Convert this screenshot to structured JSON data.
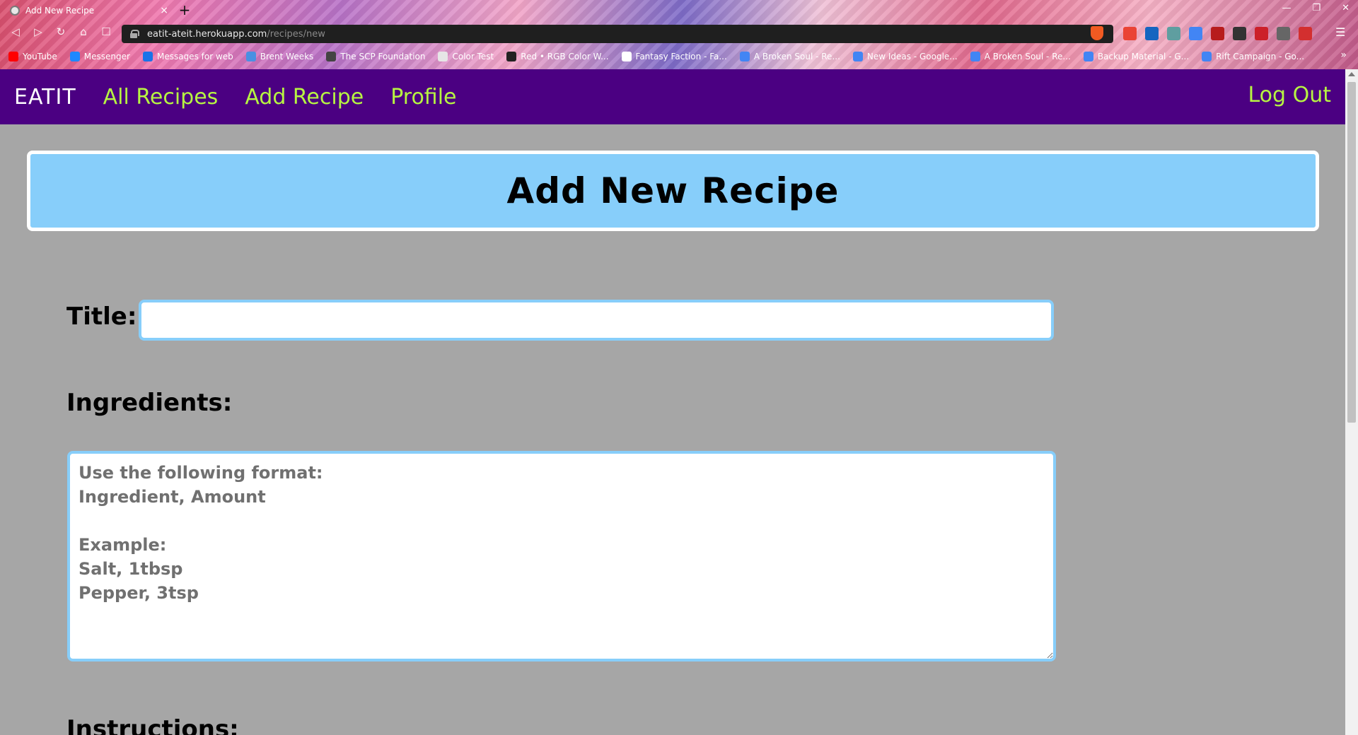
{
  "browser": {
    "tab_title": "Add New Recipe",
    "tab_close": "×",
    "new_tab": "+",
    "url_host": "eatit-ateit.herokuapp.com",
    "url_path": "/recipes/new",
    "bookmarks": [
      {
        "label": "YouTube",
        "color": "#ff0000"
      },
      {
        "label": "Messenger",
        "color": "#1e88ff"
      },
      {
        "label": "Messages for web",
        "color": "#1a73e8"
      },
      {
        "label": "Brent Weeks",
        "color": "#4a90e2"
      },
      {
        "label": "The SCP Foundation",
        "color": "#444444"
      },
      {
        "label": "Color Test",
        "color": "#e6e6e6"
      },
      {
        "label": "Red • RGB Color W...",
        "color": "#222222"
      },
      {
        "label": "Fantasy Faction - Fa...",
        "color": "#ffffff"
      },
      {
        "label": "A Broken Soul - Re...",
        "color": "#4285f4"
      },
      {
        "label": "New Ideas - Google...",
        "color": "#4285f4"
      },
      {
        "label": "A Broken Soul - Re...",
        "color": "#4285f4"
      },
      {
        "label": "Backup Material - G...",
        "color": "#4285f4"
      },
      {
        "label": "Rift Campaign - Go...",
        "color": "#4285f4"
      }
    ],
    "extensions": [
      {
        "name": "gmail-icon",
        "color": "#ea4335"
      },
      {
        "name": "extension-icon",
        "color": "#1565c0"
      },
      {
        "name": "calendar-icon",
        "color": "#5f9ea0"
      },
      {
        "name": "translate-icon",
        "color": "#4285f4"
      },
      {
        "name": "shield-icon",
        "color": "#b71c1c"
      },
      {
        "name": "ninja-icon",
        "color": "#333333"
      },
      {
        "name": "lastpass-icon",
        "color": "#cc2029"
      },
      {
        "name": "arrow-icon",
        "color": "#666666"
      },
      {
        "name": "pdf-icon",
        "color": "#d32f2f"
      }
    ]
  },
  "navbar": {
    "brand": "EATIT",
    "links": [
      "All Recipes",
      "Add Recipe",
      "Profile"
    ],
    "logout": "Log Out",
    "bg_color": "#4b0082",
    "link_color": "#b7f542"
  },
  "page": {
    "heading": "Add New Recipe",
    "title_label": "Title:",
    "title_value": "",
    "ingredients_label": "Ingredients:",
    "ingredients_placeholder": "Use the following format:\nIngredient, Amount\n\nExample:\nSalt, 1tbsp\nPepper, 3tsp",
    "instructions_label": "Instructions:",
    "banner_color": "#87cefa",
    "background_color": "#a6a6a6"
  }
}
